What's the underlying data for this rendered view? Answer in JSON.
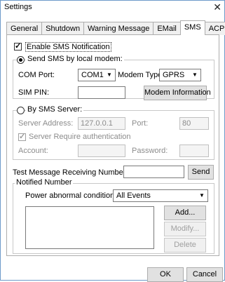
{
  "window": {
    "title": "Settings",
    "close_glyph": "✕"
  },
  "tabs": [
    {
      "label": "General"
    },
    {
      "label": "Shutdown"
    },
    {
      "label": "Warning Message"
    },
    {
      "label": "EMail"
    },
    {
      "label": "SMS",
      "active": true
    },
    {
      "label": "ACPI"
    }
  ],
  "sms": {
    "enable_label": "Enable SMS Notification",
    "enable_checked": true,
    "local_modem": {
      "radio_label": "Send SMS by local modem:",
      "selected": true,
      "com_port_label": "COM Port:",
      "com_port_value": "COM1",
      "modem_type_label": "Modem Type:",
      "modem_type_value": "GPRS",
      "sim_pin_label": "SIM PIN:",
      "sim_pin_value": "",
      "modem_info_button": "Modem Information"
    },
    "server": {
      "radio_label": "By SMS Server:",
      "selected": false,
      "address_label": "Server Address:",
      "address_value": "127.0.0.1",
      "port_label": "Port:",
      "port_value": "80",
      "require_auth_label": "Server Require authentication",
      "require_auth_checked": true,
      "account_label": "Account:",
      "account_value": "",
      "password_label": "Password:",
      "password_value": ""
    },
    "test_label": "Test Message Receiving Number:",
    "test_value": "",
    "send_button": "Send",
    "notified": {
      "group_label": "Notified Number",
      "condition_label": "Power abnormal condition:",
      "condition_value": "All Events",
      "add_button": "Add...",
      "modify_button": "Modify...",
      "delete_button": "Delete"
    }
  },
  "footer": {
    "ok": "OK",
    "cancel": "Cancel"
  }
}
